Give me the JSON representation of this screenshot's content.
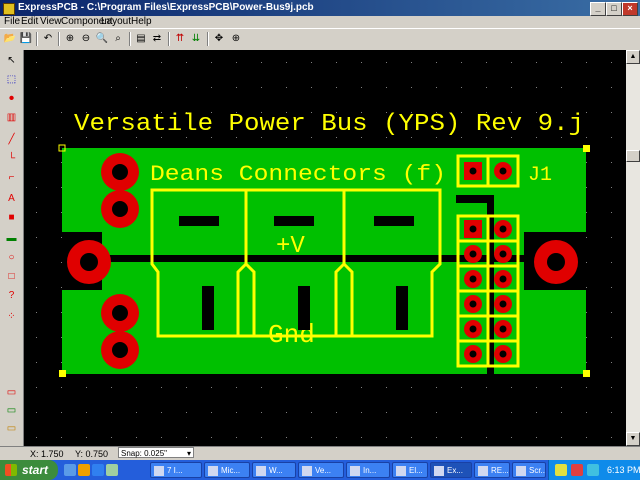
{
  "window": {
    "app_name": "ExpressPCB",
    "file_path": "C:\\Program Files\\ExpressPCB\\Power-Bus9j.pcb",
    "minimize_label": "_",
    "maximize_label": "□",
    "close_label": "×"
  },
  "menu": [
    "File",
    "Edit",
    "View",
    "Component",
    "Layout",
    "Help"
  ],
  "toolbar": [
    {
      "icon": "open-folder-icon",
      "glyph": "📂"
    },
    {
      "icon": "save-icon",
      "glyph": "💾"
    },
    {
      "icon": "undo-icon",
      "glyph": "↶"
    },
    {
      "icon": "zoom-in-icon",
      "glyph": "⊕"
    },
    {
      "icon": "zoom-out-icon",
      "glyph": "⊖"
    },
    {
      "icon": "zoom-area-icon",
      "glyph": "🔍"
    },
    {
      "icon": "zoom-fit-icon",
      "glyph": "⌕"
    },
    {
      "icon": "layers-icon",
      "glyph": "▤"
    },
    {
      "icon": "layer-swap-icon",
      "glyph": "⇄"
    },
    {
      "icon": "flip-up-icon",
      "glyph": "⇈"
    },
    {
      "icon": "flip-down-icon",
      "glyph": "⇊"
    },
    {
      "icon": "move-icon",
      "glyph": "✥"
    },
    {
      "icon": "center-icon",
      "glyph": "⊕"
    }
  ],
  "left_tools": [
    {
      "icon": "pointer-icon",
      "glyph": "↖"
    },
    {
      "icon": "select-area-icon",
      "glyph": "⬚"
    },
    {
      "icon": "place-pad-icon",
      "glyph": "•"
    },
    {
      "icon": "place-component-icon",
      "glyph": "▥"
    },
    {
      "icon": "trace-icon",
      "glyph": "╱"
    },
    {
      "icon": "trace-corner-icon",
      "glyph": "└"
    },
    {
      "icon": "trace-bend-icon",
      "glyph": "⌐"
    },
    {
      "icon": "text-icon",
      "glyph": "A"
    },
    {
      "icon": "shape-icon",
      "glyph": "■"
    },
    {
      "icon": "rounded-rect-icon",
      "glyph": "▬"
    },
    {
      "icon": "circle-icon",
      "glyph": "○"
    },
    {
      "icon": "rectangle-icon",
      "glyph": "□"
    },
    {
      "icon": "unknown-pad-icon",
      "glyph": "?"
    },
    {
      "icon": "net-icon",
      "glyph": "⁘"
    },
    {
      "icon": "layer-top-icon",
      "glyph": "▭"
    },
    {
      "icon": "layer-bottom-icon",
      "glyph": "▭"
    },
    {
      "icon": "layer-silk-icon",
      "glyph": "▭"
    }
  ],
  "board": {
    "title": "Versatile Power Bus (YPS)  Rev 9.j",
    "connectors_label": "Deans Connectors (f)",
    "ref_label": "J1",
    "plus_label": "+V",
    "gnd_label": "Gnd",
    "colors": {
      "copper": "#00c000",
      "silk": "#ffff00",
      "pad": "#ff0000",
      "background": "#000000"
    }
  },
  "status": {
    "x_label": "X: 1.750",
    "y_label": "Y: 0.750",
    "snap_label": "Snap: 0.025\""
  },
  "taskbar": {
    "start_label": "start",
    "buttons": [
      "7 I...",
      "Mic...",
      "W...",
      "Ve...",
      "In...",
      "El...",
      "Ex...",
      "RE...",
      "Scr..."
    ],
    "clock": "6:13 PM"
  }
}
